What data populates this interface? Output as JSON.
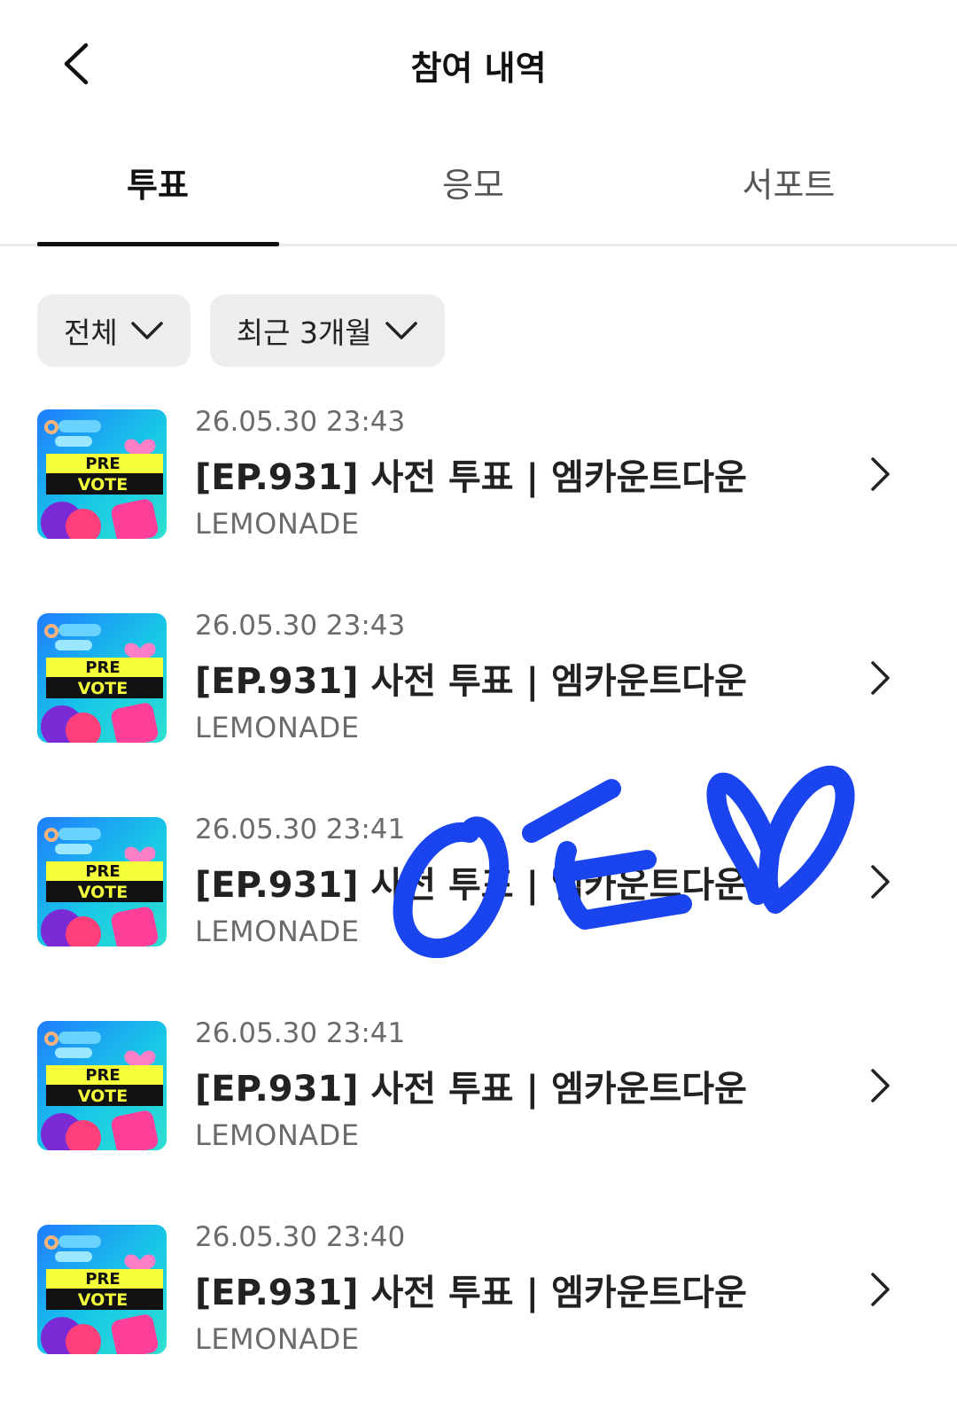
{
  "header": {
    "title": "참여 내역",
    "back_icon": "chevron-left-icon"
  },
  "tabs": [
    {
      "label": "투표",
      "active": true
    },
    {
      "label": "응모",
      "active": false
    },
    {
      "label": "서포트",
      "active": false
    }
  ],
  "filters": [
    {
      "label": "전체",
      "icon": "chevron-down-icon"
    },
    {
      "label": "최근 3개월",
      "icon": "chevron-down-icon"
    }
  ],
  "items": [
    {
      "date": "26.05.30 23:43",
      "title": "[EP.931] 사전 투표 | 엠카운트다운",
      "org": "LEMONADE",
      "thumb_text": [
        "PRE",
        "VOTE"
      ]
    },
    {
      "date": "26.05.30 23:43",
      "title": "[EP.931] 사전 투표 | 엠카운트다운",
      "org": "LEMONADE",
      "thumb_text": [
        "PRE",
        "VOTE"
      ]
    },
    {
      "date": "26.05.30 23:41",
      "title": "[EP.931] 사전 투표 | 엠카운트다운",
      "org": "LEMONADE",
      "thumb_text": [
        "PRE",
        "VOTE"
      ]
    },
    {
      "date": "26.05.30 23:41",
      "title": "[EP.931] 사전 투표 | 엠카운트다운",
      "org": "LEMONADE",
      "thumb_text": [
        "PRE",
        "VOTE"
      ]
    },
    {
      "date": "26.05.30 23:40",
      "title": "[EP.931] 사전 투표 | 엠카운트다운",
      "org": "LEMONADE",
      "thumb_text": [
        "PRE",
        "VOTE"
      ]
    }
  ],
  "colors": {
    "active_underline": "#111111",
    "chip_bg": "#ededf0",
    "scribble": "#1a44ee"
  }
}
